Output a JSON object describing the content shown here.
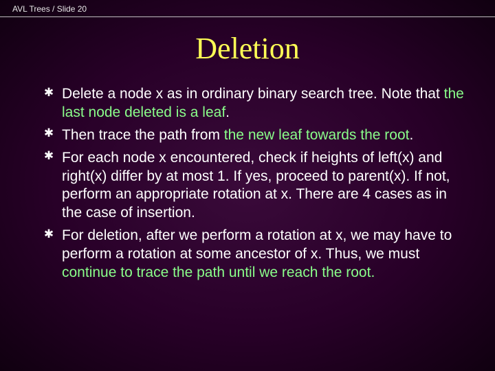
{
  "header": {
    "left": "AVL Trees / Slide 20"
  },
  "title": "Deletion",
  "bullets": [
    {
      "parts": [
        {
          "text": "Delete a node x as in ordinary binary search tree. Note that ",
          "hl": false
        },
        {
          "text": "the last node deleted is a leaf",
          "hl": true
        },
        {
          "text": ".",
          "hl": false
        }
      ]
    },
    {
      "parts": [
        {
          "text": "Then trace the path from ",
          "hl": false
        },
        {
          "text": "the new leaf towards the root",
          "hl": true
        },
        {
          "text": ".",
          "hl": false
        }
      ]
    },
    {
      "parts": [
        {
          "text": "For each node x encountered, check if heights of left(x) and right(x) differ by at most 1.  If yes, proceed to parent(x).  If not, perform an appropriate rotation at x.  There are 4 cases as in the case of insertion.",
          "hl": false
        }
      ]
    },
    {
      "parts": [
        {
          "text": "For deletion, after we perform a rotation at x, we may have to perform a rotation at some ancestor of x.  Thus, we must ",
          "hl": false
        },
        {
          "text": "continue to trace the path until we reach the root.",
          "hl": true
        }
      ]
    }
  ],
  "bullet_glyph": "✱"
}
